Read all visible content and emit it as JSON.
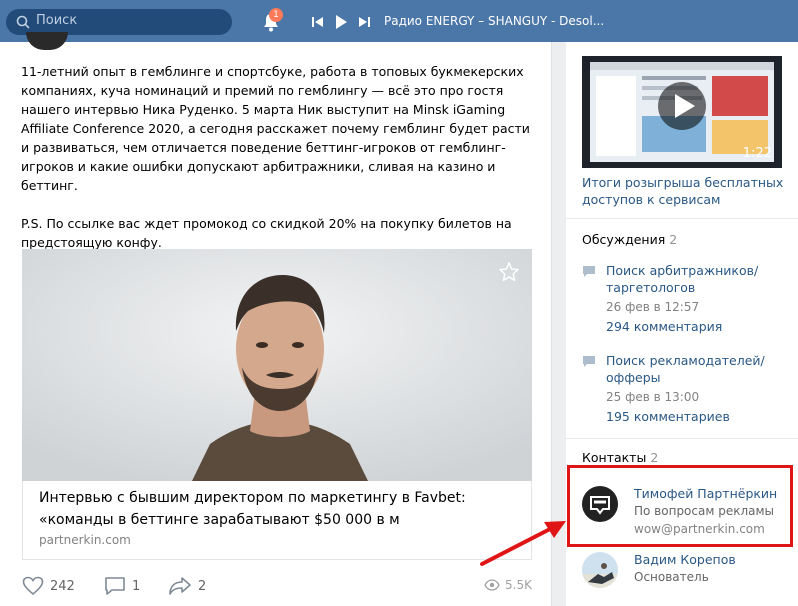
{
  "topbar": {
    "search_placeholder": "Поиск",
    "notifications_count": "1",
    "player_track": "Радио ENERGY – SHANGUY - Desol..."
  },
  "post": {
    "paragraphs": [
      "11-летний опыт в гемблинге и спортсбуке, работа в топовых букмекерских компаниях, куча номинаций и премий по гемблингу — всё это про гостя нашего интервью Ника Руденко. 5 марта Ник выступит на Minsk iGaming Affiliate Conference 2020, а сегодня расскажет почему гемблинг будет расти и развиваться, чем отличается поведение беттинг-игроков от гемблинг-игроков и какие ошибки допускают арбитражники, сливая на казино и беттинг.",
      "P.S. По ссылке вас ждет промокод со скидкой 20% на покупку билетов на предстоящую конфу."
    ],
    "link": {
      "title": "Интервью с бывшим директором по маркетингу в Favbet: «команды в беттинге зарабатывают $50 000 в м",
      "source": "partnerkin.com"
    },
    "actions": {
      "likes": "242",
      "comments": "1",
      "shares": "2",
      "views": "5.5K"
    }
  },
  "sidebar": {
    "video": {
      "duration": "1:22",
      "title": "Итоги розыгрыша бесплатных доступов к сервисам"
    },
    "discussions": {
      "header": "Обсуждения",
      "count": "2",
      "items": [
        {
          "title": "Поиск арбитражников/ таргетологов",
          "date": "26 фев в 12:57",
          "comments": "294 комментария"
        },
        {
          "title": "Поиск рекламодателей/ офферы",
          "date": "25 фев в 13:00",
          "comments": "195 комментариев"
        }
      ]
    },
    "contacts": {
      "header": "Контакты",
      "count": "2",
      "items": [
        {
          "name": "Тимофей Партнёркин",
          "role": "По вопросам рекламы",
          "email": "wow@partnerkin.com"
        },
        {
          "name": "Вадим Корепов",
          "role": "Основатель",
          "email": ""
        }
      ]
    }
  },
  "colors": {
    "header_bg": "#4a76a8",
    "link": "#2a5885",
    "highlight": "#e01515"
  }
}
